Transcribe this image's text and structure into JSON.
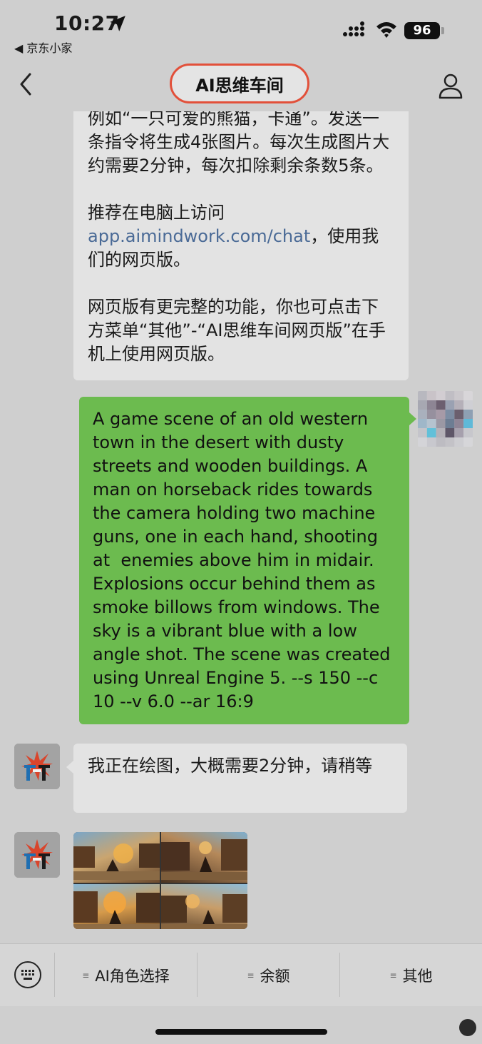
{
  "status_bar": {
    "time": "10:27",
    "back_app": "◀ 京东小家",
    "battery": "96"
  },
  "nav": {
    "title": "AI思维车间"
  },
  "messages": {
    "bot_intro_1": "例如“一只可爱的熊猫，卡通”。发送一条指令将生成4张图片。每次生成图片大约需要2分钟，每次扣除剩余条数5条。",
    "bot_intro_2_prefix": "推荐在电脑上访问",
    "bot_intro_2_link": "app.aimindwork.com/chat",
    "bot_intro_2_suffix": "，使用我们的网页版。",
    "bot_intro_3": "网页版有更完整的功能，你也可点击下方菜单“其他”-“AI思维车间网页版”在手机上使用网页版。",
    "user_prompt": "A game scene of an old western town in the desert with dusty streets and wooden buildings. A man on horseback rides towards the camera holding two machine guns, one in each hand, shooting at  enemies above him in midair. Explosions occur behind them as smoke billows from windows. The sky is a vibrant blue with a low angle shot. The scene was created using Unreal Engine 5. --s 150 --c 10 --v 6.0 --ar 16:9",
    "bot_drawing": "我正在绘图，大概需要2分钟，请稍等"
  },
  "menu": {
    "item1": "AI角色选择",
    "item2": "余额",
    "item3": "其他"
  },
  "colors": {
    "user_bubble": "#6cbb4f",
    "bot_bubble": "#e3e3e3",
    "background": "#cfcfcf",
    "title_highlight": "#e2503a",
    "link": "#4a6a96"
  }
}
